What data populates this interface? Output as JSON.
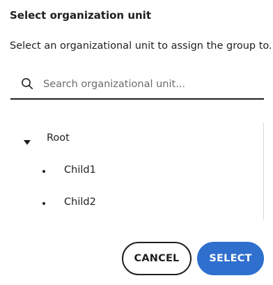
{
  "dialog": {
    "title": "Select organization unit",
    "description": "Select an organizational unit to assign the group to."
  },
  "search": {
    "placeholder": "Search organizational unit...",
    "value": "",
    "icon": "search-icon"
  },
  "tree": {
    "root": {
      "label": "Root",
      "icon": "caret-down-icon",
      "expanded": true
    },
    "children": [
      {
        "label": "Child1",
        "icon": "bullet-icon"
      },
      {
        "label": "Child2",
        "icon": "bullet-icon"
      }
    ]
  },
  "actions": {
    "cancel_label": "CANCEL",
    "select_label": "SELECT"
  },
  "colors": {
    "primary": "#2f6fce",
    "text": "#1f1f1f",
    "placeholder": "#6b6b6b",
    "background": "#ffffff"
  }
}
